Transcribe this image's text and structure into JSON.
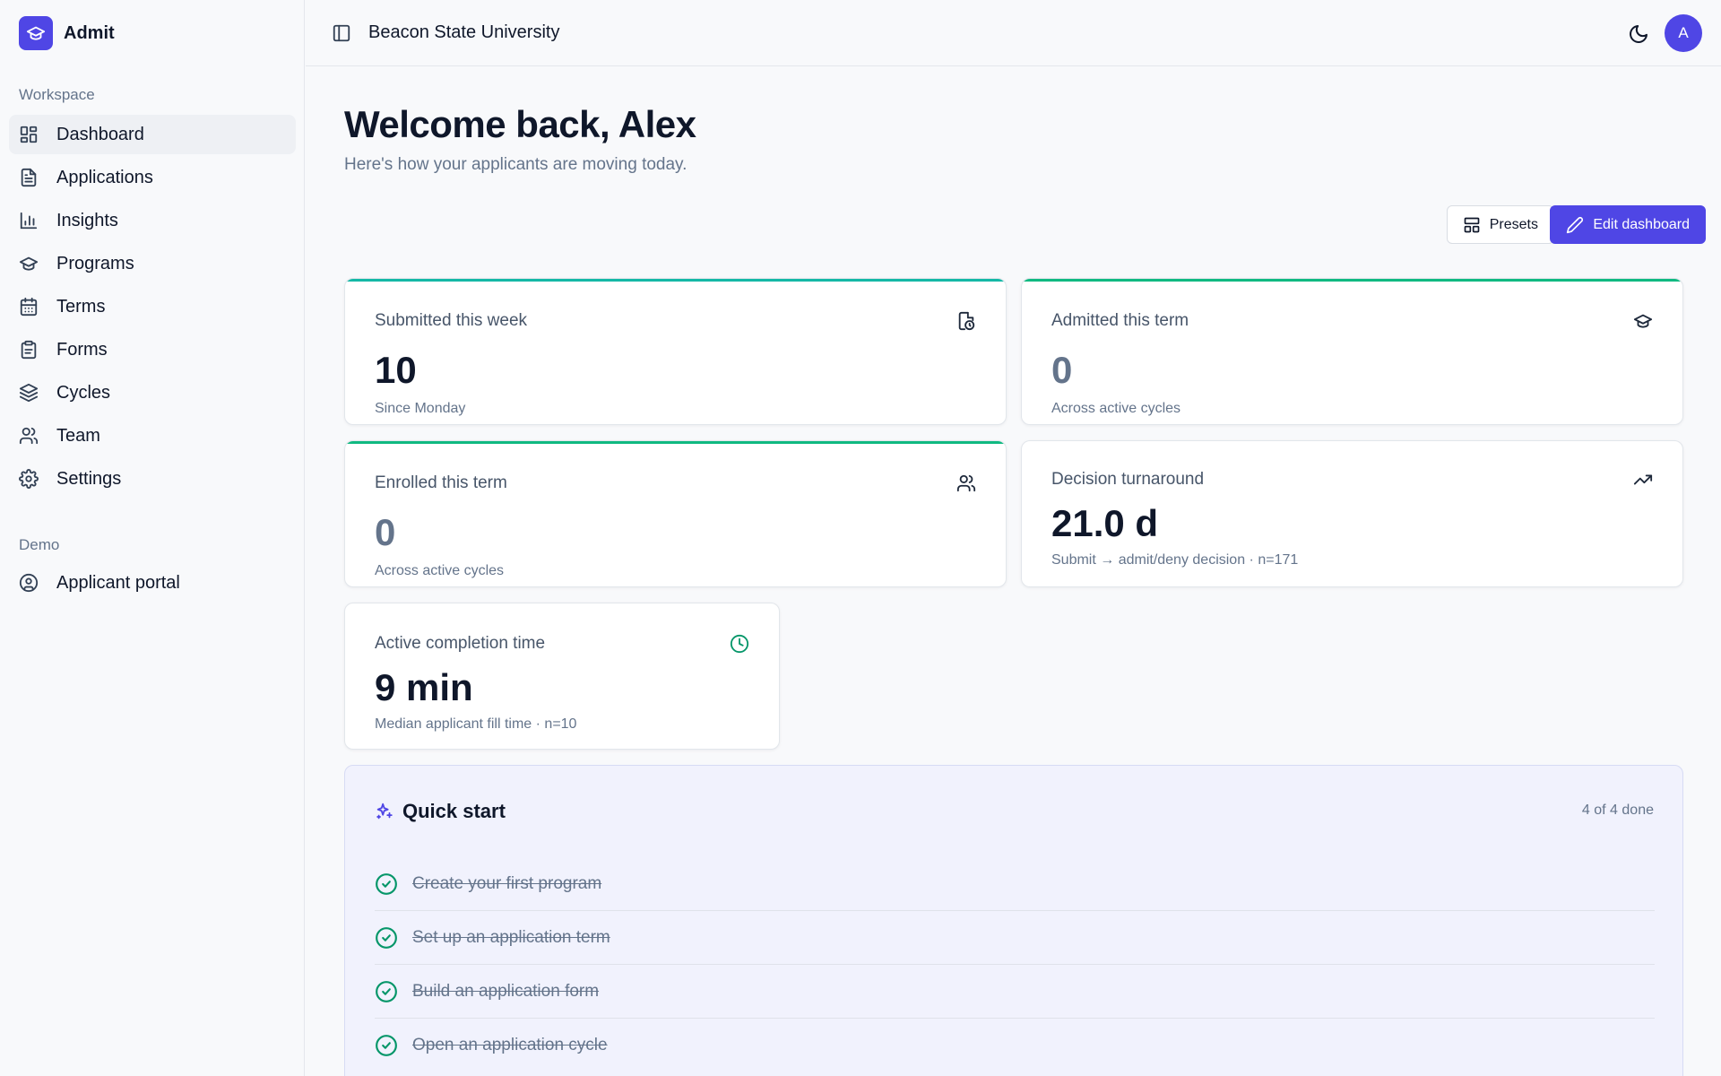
{
  "app": {
    "name": "Admit",
    "org": "Beacon State University",
    "avatar_initial": "A"
  },
  "colors": {
    "accent": "#4f46e5",
    "teal": "#14b8a6",
    "green": "#10b981",
    "success": "#059669"
  },
  "sidebar": {
    "workspace_label": "Workspace",
    "items": [
      {
        "label": "Dashboard",
        "icon": "dashboard-icon",
        "active": true
      },
      {
        "label": "Applications",
        "icon": "file-text-icon"
      },
      {
        "label": "Insights",
        "icon": "bar-chart-icon"
      },
      {
        "label": "Programs",
        "icon": "graduation-cap-icon"
      },
      {
        "label": "Terms",
        "icon": "calendar-icon"
      },
      {
        "label": "Forms",
        "icon": "clipboard-icon"
      },
      {
        "label": "Cycles",
        "icon": "layers-icon"
      },
      {
        "label": "Team",
        "icon": "users-icon"
      },
      {
        "label": "Settings",
        "icon": "gear-icon"
      }
    ],
    "demo_label": "Demo",
    "demo_items": [
      {
        "label": "Applicant portal",
        "icon": "user-circle-icon"
      }
    ]
  },
  "header": {
    "title": "Welcome back, Alex",
    "subtitle": "Here's how your applicants are moving today."
  },
  "actions": {
    "presets_label": "Presets",
    "edit_label": "Edit dashboard"
  },
  "stats": {
    "submitted": {
      "label": "Submitted this week",
      "value": "10",
      "note": "Since Monday",
      "icon": "file-clock-icon"
    },
    "admitted": {
      "label": "Admitted this term",
      "value": "0",
      "note": "Across active cycles",
      "icon": "graduation-cap-icon"
    },
    "enrolled": {
      "label": "Enrolled this term",
      "value": "0",
      "note": "Across active cycles",
      "icon": "users-icon"
    },
    "turnaround": {
      "label": "Decision turnaround",
      "value": "21.0 d",
      "note": "Submit → admit/deny decision · n=171",
      "icon": "trending-up-icon"
    },
    "completion": {
      "label": "Active completion time",
      "value": "9 min",
      "note": "Median applicant fill time · n=10",
      "icon": "clock-icon"
    }
  },
  "quick_start": {
    "title": "Quick start",
    "progress": "4 of 4 done",
    "tasks": [
      {
        "label": "Create your first program",
        "done": true
      },
      {
        "label": "Set up an application term",
        "done": true
      },
      {
        "label": "Build an application form",
        "done": true
      },
      {
        "label": "Open an application cycle",
        "done": true
      }
    ]
  }
}
